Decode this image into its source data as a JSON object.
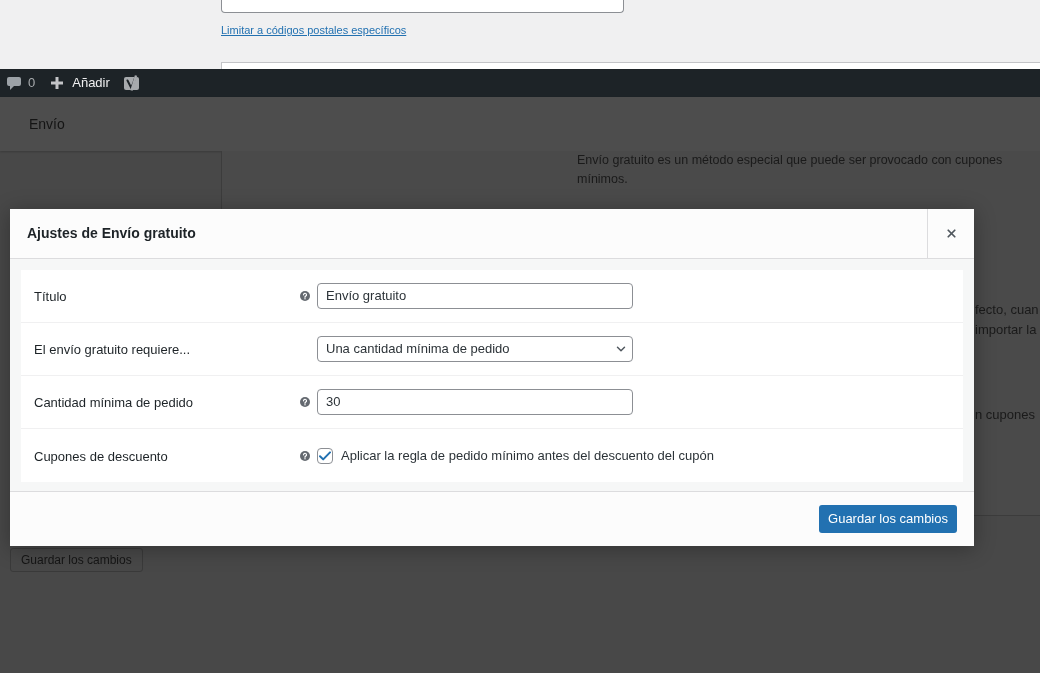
{
  "top_section": {
    "link": "Limitar a códigos postales específicos"
  },
  "admin_bar": {
    "comments_count": "0",
    "add_label": "Añadir"
  },
  "page_header": {
    "title": "Envío"
  },
  "background": {
    "description_lines": [
      "Envío gratuito es un método especial que puede ser provocado con cupones",
      "mínimos."
    ],
    "fragment_rows": [
      [
        "fecto, cuan",
        "importar la"
      ],
      [
        "n cupones"
      ]
    ],
    "save_button": "Guardar los cambios"
  },
  "modal": {
    "title": "Ajustes de Envío gratuito",
    "fields": [
      {
        "kind": "text",
        "label": "Título",
        "help": true,
        "value": "Envío gratuito"
      },
      {
        "kind": "select",
        "label": "El envío gratuito requiere...",
        "help": false,
        "value": "Una cantidad mínima de pedido"
      },
      {
        "kind": "text",
        "label": "Cantidad mínima de pedido",
        "help": true,
        "value": "30"
      },
      {
        "kind": "checkbox",
        "label": "Cupones de descuento",
        "help": true,
        "checked": true,
        "option": "Aplicar la regla de pedido mínimo antes del descuento del cupón"
      }
    ],
    "save_button": "Guardar los cambios"
  }
}
